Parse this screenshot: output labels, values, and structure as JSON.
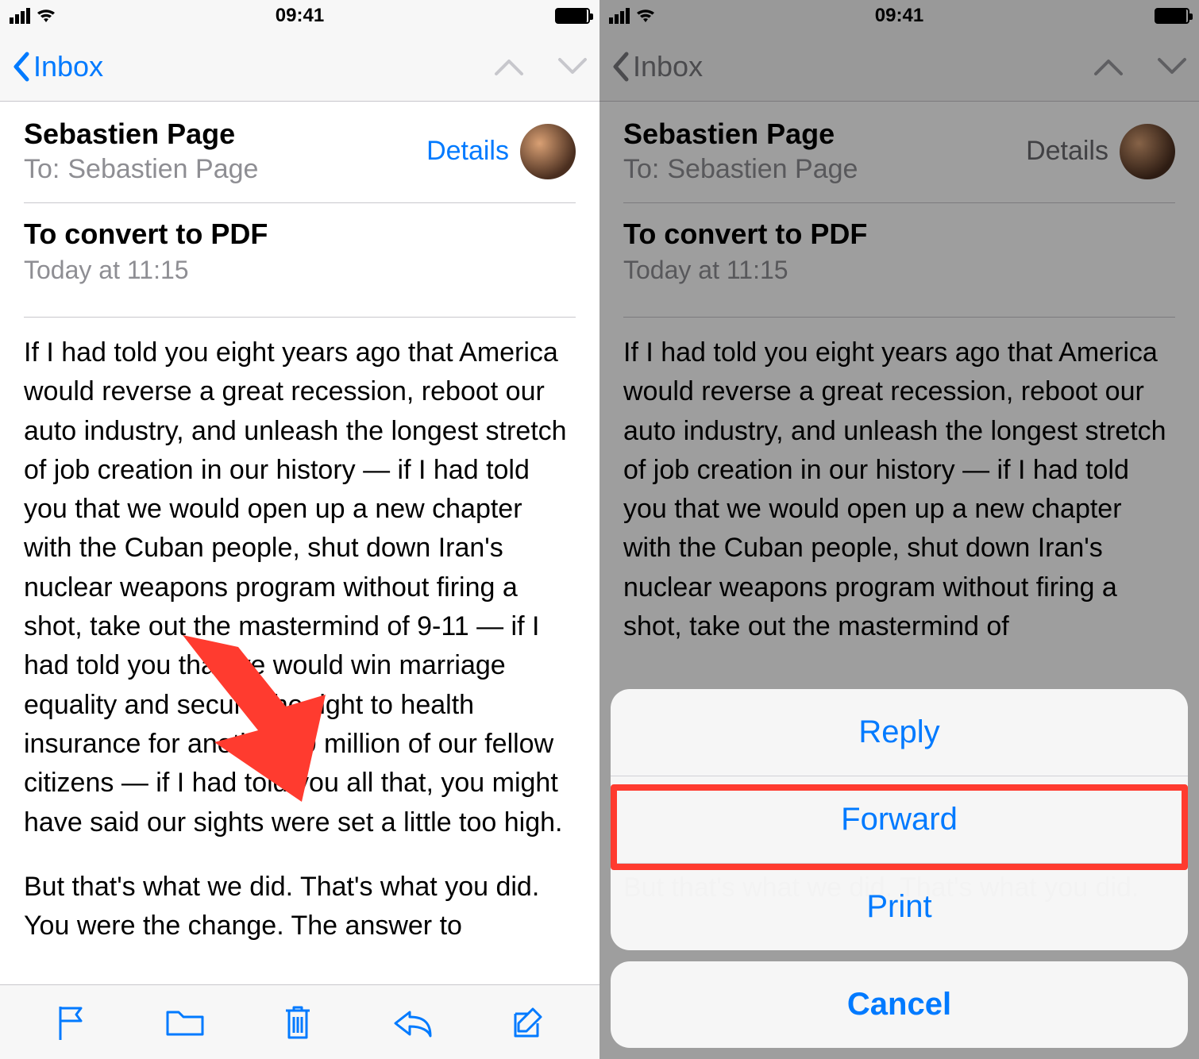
{
  "status": {
    "time": "09:41"
  },
  "nav": {
    "back_label": "Inbox"
  },
  "header": {
    "from_name": "Sebastien Page",
    "to_label": "To:",
    "to_name": "Sebastien Page",
    "details": "Details"
  },
  "subject": {
    "title": "To convert to PDF",
    "date": "Today at 11:15"
  },
  "body": {
    "p1": "If I had told you eight years ago that America would reverse a great recession, reboot our auto industry, and unleash the longest stretch of job creation in our history — if I had told you that we would open up a new chapter with the Cuban people, shut down Iran's nuclear weapons program without firing a shot, take out the mastermind of 9-11 — if I had told you that we would win marriage equality and secure the right to health insurance for another 20 million of our fellow citizens — if I had told you all that, you might have said our sights were set a little too high.",
    "p2": "But that's what we did. That's what you did. You were the change. The answer to",
    "p1_short": "If I had told you eight years ago that America would reverse a great recession, reboot our auto industry, and unleash the longest stretch of job creation in our history — if I had told you that we would open up a new chapter with the Cuban people, shut down Iran's nuclear weapons program without firing a shot, take out the mastermind of",
    "p2_peek": "But that's what we did. That's what you did."
  },
  "action_sheet": {
    "reply": "Reply",
    "forward": "Forward",
    "print": "Print",
    "cancel": "Cancel"
  },
  "colors": {
    "tint": "#007aff",
    "annotation": "#ff3b2f"
  }
}
